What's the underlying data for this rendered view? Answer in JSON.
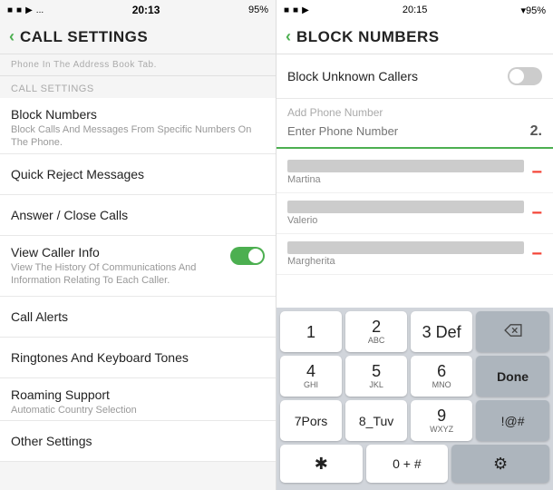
{
  "left": {
    "statusBar": {
      "icons": "■ ■ ▶ ...",
      "battery": "95%",
      "time": "20:13"
    },
    "header": {
      "backLabel": "‹",
      "title": "CALL SETTINGS"
    },
    "topNote": "Phone In The Address Book Tab.",
    "sectionLabel": "CALL SETTINGS",
    "menuItems": [
      {
        "title": "Block Numbers",
        "subtitle": "Block Calls And Messages From Specific Numbers On The Phone."
      },
      {
        "title": "Quick Reject Messages",
        "subtitle": ""
      },
      {
        "title": "Answer / Close Calls",
        "subtitle": ""
      },
      {
        "title": "View Caller Info",
        "subtitle": "View The History Of Communications And Information Relating To Each Caller.",
        "hasToggle": true,
        "toggleOn": true
      },
      {
        "title": "Call Alerts",
        "subtitle": ""
      },
      {
        "title": "Ringtones And Keyboard Tones",
        "subtitle": ""
      },
      {
        "title": "Roaming Support",
        "subtitle": "Automatic Country Selection"
      },
      {
        "title": "Other Settings",
        "subtitle": ""
      }
    ]
  },
  "right": {
    "statusBar": {
      "icons": "■ ■ ▶",
      "battery": "▾95%",
      "time": "20:15"
    },
    "header": {
      "backLabel": "‹",
      "title": "BLOCK NUMBERS"
    },
    "blockUnknown": {
      "label": "Block Unknown Callers",
      "toggleOn": false
    },
    "addPhone": {
      "label": "Add Phone Number",
      "placeholder": "Enter Phone Number",
      "numberHint": "2."
    },
    "contacts": [
      {
        "name": "Martina"
      },
      {
        "name": "Valerio"
      },
      {
        "name": "Margherita"
      }
    ],
    "keyboard": {
      "rows": [
        [
          {
            "num": "1",
            "letters": ""
          },
          {
            "num": "2",
            "letters": "ABC"
          },
          {
            "num": "3 Def",
            "letters": "",
            "action": "backspace"
          }
        ],
        [
          {
            "num": "4",
            "letters": "GHI"
          },
          {
            "num": "5",
            "letters": "JKL"
          },
          {
            "num": "6",
            "letters": "MNO",
            "action": "done"
          }
        ],
        [
          {
            "num": "7Pors",
            "letters": ""
          },
          {
            "num": "8_Tuv",
            "letters": ""
          },
          {
            "num": "9",
            "letters": "WXYZ",
            "action": "symbols"
          }
        ],
        [
          {
            "num": "✱",
            "letters": ""
          },
          {
            "num": "0 + #",
            "letters": ""
          },
          {
            "num": "⚙",
            "letters": "",
            "action": "settings"
          }
        ]
      ]
    }
  }
}
